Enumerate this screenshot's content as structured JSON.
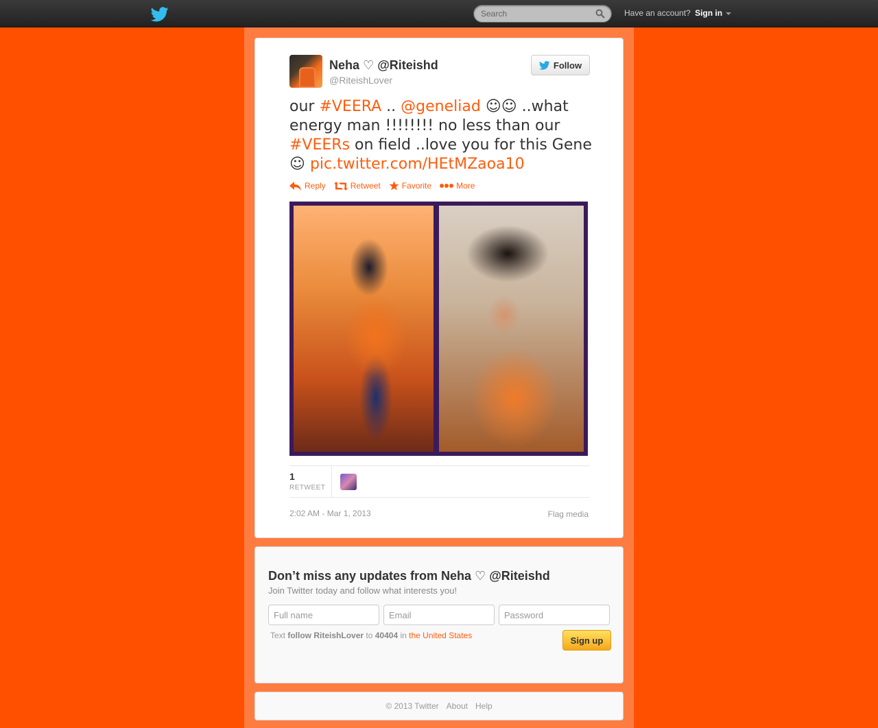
{
  "topbar": {
    "search_placeholder": "Search",
    "have_account": "Have an account?",
    "sign_in": "Sign in"
  },
  "tweet": {
    "fullname": "Neha",
    "heart": "♡",
    "fullname_handle": "@Riteishd",
    "username": "@RiteishLover",
    "follow_label": "Follow",
    "text_parts": [
      {
        "t": "our ",
        "link": false
      },
      {
        "t": "#VEERA",
        "link": true
      },
      {
        "t": " .. ",
        "link": false
      },
      {
        "t": "@geneliad",
        "link": true
      },
      {
        "t": " ☺☺ ..what energy man !!!!!!!! no less than our ",
        "link": false
      },
      {
        "t": "#VEERs",
        "link": true
      },
      {
        "t": " on field ..love you for this Gene ☺ ",
        "link": false
      },
      {
        "t": "pic.twitter.com/HEtMZaoa10",
        "link": true
      }
    ],
    "actions": {
      "reply": "Reply",
      "retweet": "Retweet",
      "favorite": "Favorite",
      "more": "More"
    },
    "stats": {
      "retweet_count": "1",
      "retweet_label": "RETWEET"
    },
    "timestamp": "2:02 AM - Mar 1, 2013",
    "flag_media": "Flag media"
  },
  "signup": {
    "title": "Don’t miss any updates from Neha ♡ @Riteishd",
    "subtitle": "Join Twitter today and follow what interests you!",
    "fullname_placeholder": "Full name",
    "email_placeholder": "Email",
    "password_placeholder": "Password",
    "sms_text": "Text",
    "sms_command": "follow RiteishLover",
    "sms_to": "to",
    "sms_number": "40404",
    "sms_in": "in",
    "sms_country": "the United States",
    "button": "Sign up"
  },
  "footer": {
    "copyright": "© 2013 Twitter",
    "about": "About",
    "help": "Help"
  },
  "colors": {
    "background": "#ff5000",
    "link": "#ff5c0c",
    "column": "#ff7c40"
  }
}
